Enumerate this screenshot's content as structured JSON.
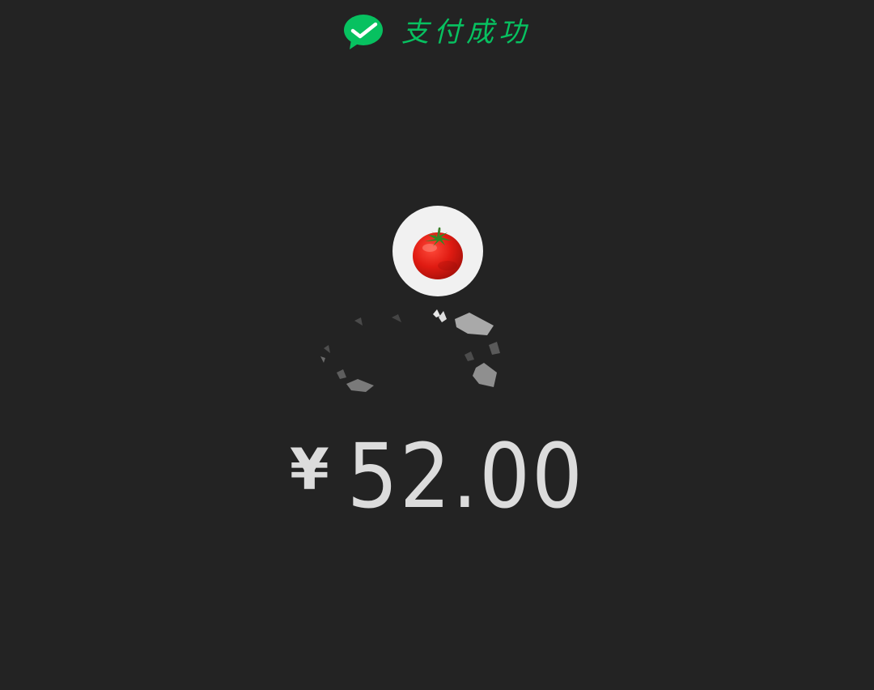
{
  "header": {
    "status_text": "支付成功",
    "logo_icon": "wechat-pay-icon",
    "accent_color": "#07c160"
  },
  "merchant": {
    "avatar_icon": "tomato-icon"
  },
  "payment": {
    "currency_symbol": "¥",
    "amount": "52.00"
  },
  "colors": {
    "background": "#232323",
    "amount_text": "#dcdcdc",
    "avatar_bg": "#f1f1f1"
  }
}
